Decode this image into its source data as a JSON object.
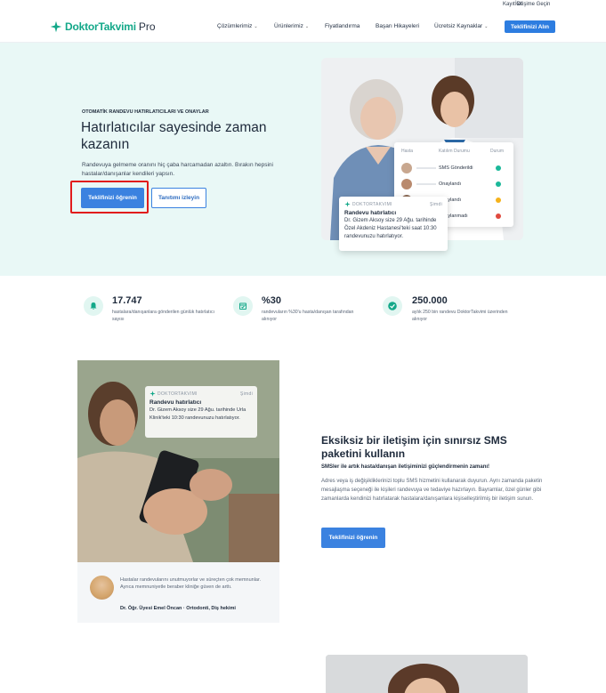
{
  "topbar": {
    "signup": "Kayıt Ol",
    "contact": "İletişime Geçin"
  },
  "header": {
    "logo_name": "DoktorTakvimi",
    "logo_suffix": "Pro",
    "nav": [
      {
        "label": "Çözümlerimiz"
      },
      {
        "label": "Ürünlerimiz"
      },
      {
        "label": "Fiyatlandırma"
      },
      {
        "label": "Başarı Hikayeleri"
      },
      {
        "label": "Ücretsiz Kaynaklar"
      }
    ],
    "cta": "Teklifinizi Alın"
  },
  "hero": {
    "eyebrow": "OTOMATİK RANDEVU HATIRLATICILARI VE ONAYLAR",
    "title": "Hatırlatıcılar sayesinde zaman kazanın",
    "description": "Randevuya gelmeme oranını hiç çaba harcamadan azaltın. Bırakın hepsini hastalar/danışanlar kendileri yapsın.",
    "primary_button": "Teklifinizi öğrenin",
    "secondary_button": "Tanıtımı izleyin",
    "status_card": {
      "col_patient": "Hasta",
      "col_status": "Katılım Durumu",
      "col_state": "Durum",
      "rows": [
        {
          "status": "SMS Gönderildi",
          "color": "#1bb89a"
        },
        {
          "status": "Onaylandı",
          "color": "#1bb89a"
        },
        {
          "status": "Onaylandı",
          "color": "#f5b21b"
        },
        {
          "status": "Onaylanmadı",
          "color": "#e04a3f"
        }
      ]
    },
    "notification": {
      "app": "DOKTORTAKVIMI",
      "time": "Şimdi",
      "title": "Randevu hatırlatıcı",
      "body": "Dr. Gizem Aksoy size 29 Ağu. tarihinde Özel Akdeniz Hastanesi'teki saat 10:30 randevunuzu hatırlatıyor."
    }
  },
  "stats": [
    {
      "icon": "bell-icon",
      "value": "17.747",
      "desc": "hastalara/danışanlara gönderilen günlük hatırlatıcı sayısı"
    },
    {
      "icon": "calendar-check-icon",
      "value": "%30",
      "desc": "randevuların %30'u hasta/danışan tarafından alınıyor"
    },
    {
      "icon": "check-circle-icon",
      "value": "250.000",
      "desc": "aylık 250 bin randevu DoktorTakvimi üzerinden alınıyor"
    }
  ],
  "sms_section": {
    "notification": {
      "app": "DOKTORTAKVIMI",
      "time": "Şimdi",
      "title": "Randevu hatırlatıcı",
      "body": "Dr. Gizem Aksoy size 29 Ağu. tarihinde Urla Klinik'teki 10:30 randevunuzu hatırlatıyor."
    },
    "testimonial": {
      "quote": "Hastalar randevularını unutmuyorlar ve süreçten çok memnunlar. Ayrıca memnuniyetle beraber kliniğe güven de arttı.",
      "author": "Dr. Öğr. Üyesi Emel Öncan · Ortodonti, Diş hekimi"
    },
    "title": "Eksiksiz bir iletişim için sınırsız SMS paketini kullanın",
    "subtitle": "SMSler ile artık hasta/danışan iletişiminizi güçlendirmenin zamanı!",
    "body": "Adres veya iş değişikliklerinizi toplu SMS hizmetini kullanarak duyurun. Aynı zamanda paketin mesajlaşma seçeneği ile kişileri randevuya ve tedaviye hazırlayın. Bayramlar, özel günler gibi zamanlarda kendinizi hatırlatarak hastalara/danışanlara kişiselleştirilmiş bir iletişim sunun.",
    "button": "Teklifinizi öğrenin"
  },
  "colors": {
    "brand": "#13a889",
    "accent": "#3b82e0",
    "hero_bg": "#e9f8f6",
    "highlight": "#e11c1c"
  }
}
